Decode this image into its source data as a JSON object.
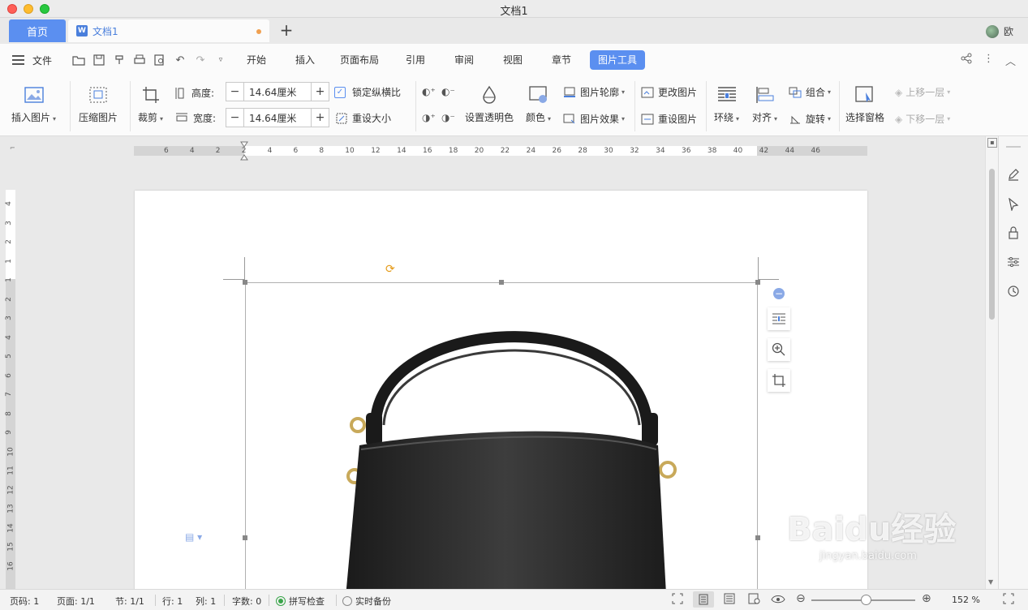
{
  "window": {
    "title": "文档1"
  },
  "tabs": {
    "home": "首页",
    "doc": "文档1",
    "user": "欧"
  },
  "menu": {
    "file": "文件",
    "tabs": [
      "开始",
      "插入",
      "页面布局",
      "引用",
      "审阅",
      "视图",
      "章节",
      "图片工具"
    ],
    "active": "图片工具"
  },
  "ribbon": {
    "insert_image": "插入图片",
    "compress_image": "压缩图片",
    "crop": "裁剪",
    "height_label": "高度:",
    "height_value": "14.64厘米",
    "width_label": "宽度:",
    "width_value": "14.64厘米",
    "lock_ratio": "锁定纵横比",
    "reset_size": "重设大小",
    "set_transparent": "设置透明色",
    "color": "颜色",
    "outline": "图片轮廓",
    "effect": "图片效果",
    "change_image": "更改图片",
    "reset_image": "重设图片",
    "wrap": "环绕",
    "align": "对齐",
    "group": "组合",
    "rotate": "旋转",
    "select_pane": "选择窗格",
    "bring_forward": "上移一层",
    "send_backward": "下移一层"
  },
  "ruler": {
    "h_ticks": [
      "6",
      "4",
      "2",
      "2",
      "4",
      "6",
      "8",
      "10",
      "12",
      "14",
      "16",
      "18",
      "20",
      "22",
      "24",
      "26",
      "28",
      "30",
      "32",
      "34",
      "36",
      "38",
      "40",
      "42",
      "44",
      "46"
    ],
    "v_ticks": [
      "4",
      "3",
      "2",
      "1",
      "1",
      "2",
      "3",
      "4",
      "5",
      "6",
      "7",
      "8",
      "9",
      "10",
      "11",
      "12",
      "13",
      "14",
      "15",
      "16"
    ]
  },
  "status": {
    "page_num": "页码: 1",
    "pages": "页面: 1/1",
    "section": "节: 1/1",
    "row": "行: 1",
    "col": "列: 1",
    "words": "字数: 0",
    "spell": "拼写检查",
    "backup": "实时备份",
    "zoom": "152 %",
    "zoom_level": 0.52
  },
  "watermark": {
    "brand": "Baidu经验",
    "url": "jingyan.baidu.com"
  },
  "colors": {
    "accent": "#5b8ff0",
    "rotate_handle": "#e59a17"
  }
}
